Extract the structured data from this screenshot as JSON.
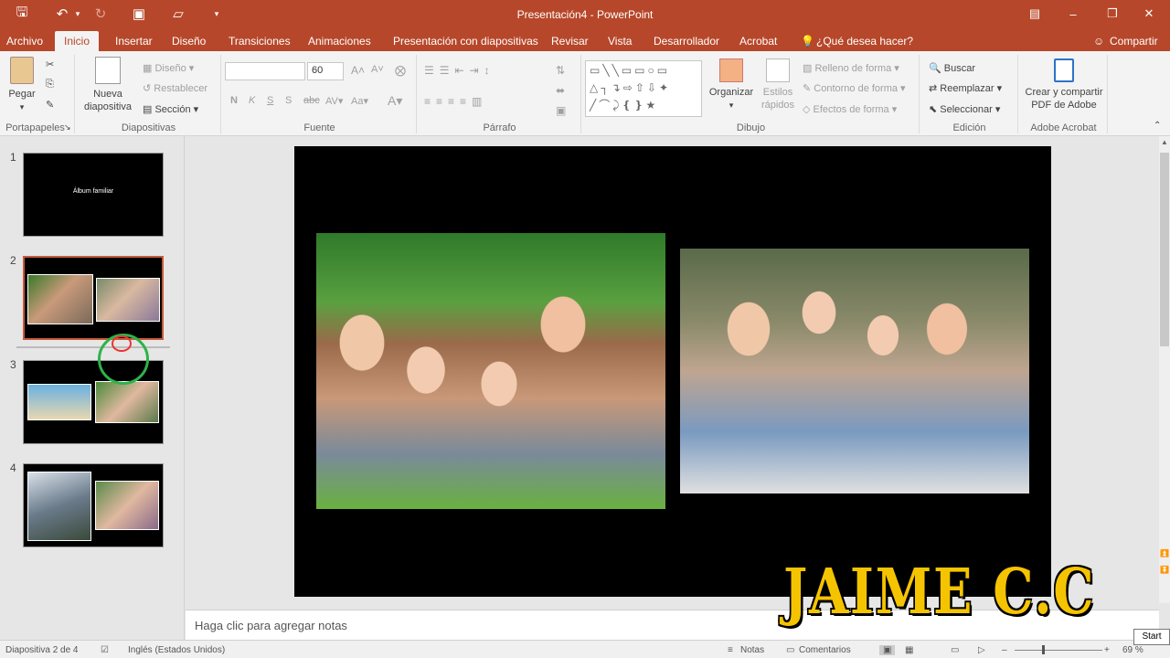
{
  "app": {
    "title": "Presentación4 - PowerPoint"
  },
  "tabs": [
    "Archivo",
    "Inicio",
    "Insertar",
    "Diseño",
    "Transiciones",
    "Animaciones",
    "Presentación con diapositivas",
    "Revisar",
    "Vista",
    "Desarrollador",
    "Acrobat",
    "¿Qué desea hacer?"
  ],
  "share_label": "Compartir",
  "ribbon": {
    "portapapeles": {
      "paste": "Pegar",
      "group": "Portapapeles"
    },
    "diapositivas": {
      "new_line1": "Nueva",
      "new_line2": "diapositiva",
      "layout": "Diseño",
      "reset": "Restablecer",
      "section": "Sección",
      "group": "Diapositivas"
    },
    "fuente": {
      "font_value": "",
      "size_value": "60",
      "bold": "N",
      "italic": "K",
      "underline": "S",
      "strike": "S",
      "spacing": "abc",
      "group": "Fuente"
    },
    "parrafo": {
      "group": "Párrafo"
    },
    "dibujo": {
      "arrange": "Organizar",
      "styles_line1": "Estilos",
      "styles_line2": "rápidos",
      "fill": "Relleno de forma",
      "outline": "Contorno de forma",
      "effects": "Efectos de forma",
      "group": "Dibujo"
    },
    "edicion": {
      "find": "Buscar",
      "replace": "Reemplazar",
      "select": "Seleccionar",
      "group": "Edición"
    },
    "acrobat": {
      "line1": "Crear y compartir",
      "line2": "PDF de Adobe",
      "group": "Adobe Acrobat"
    }
  },
  "slides": [
    {
      "number": "1",
      "text": "Álbum familiar"
    },
    {
      "number": "2"
    },
    {
      "number": "3"
    },
    {
      "number": "4"
    }
  ],
  "notes_placeholder": "Haga clic para agregar notas",
  "status": {
    "slide_info": "Diapositiva 2 de 4",
    "language": "Inglés (Estados Unidos)",
    "notes": "Notas",
    "comments": "Comentarios",
    "zoom": "69 %"
  },
  "watermark": "JAIME C.C",
  "start_label": "Start"
}
